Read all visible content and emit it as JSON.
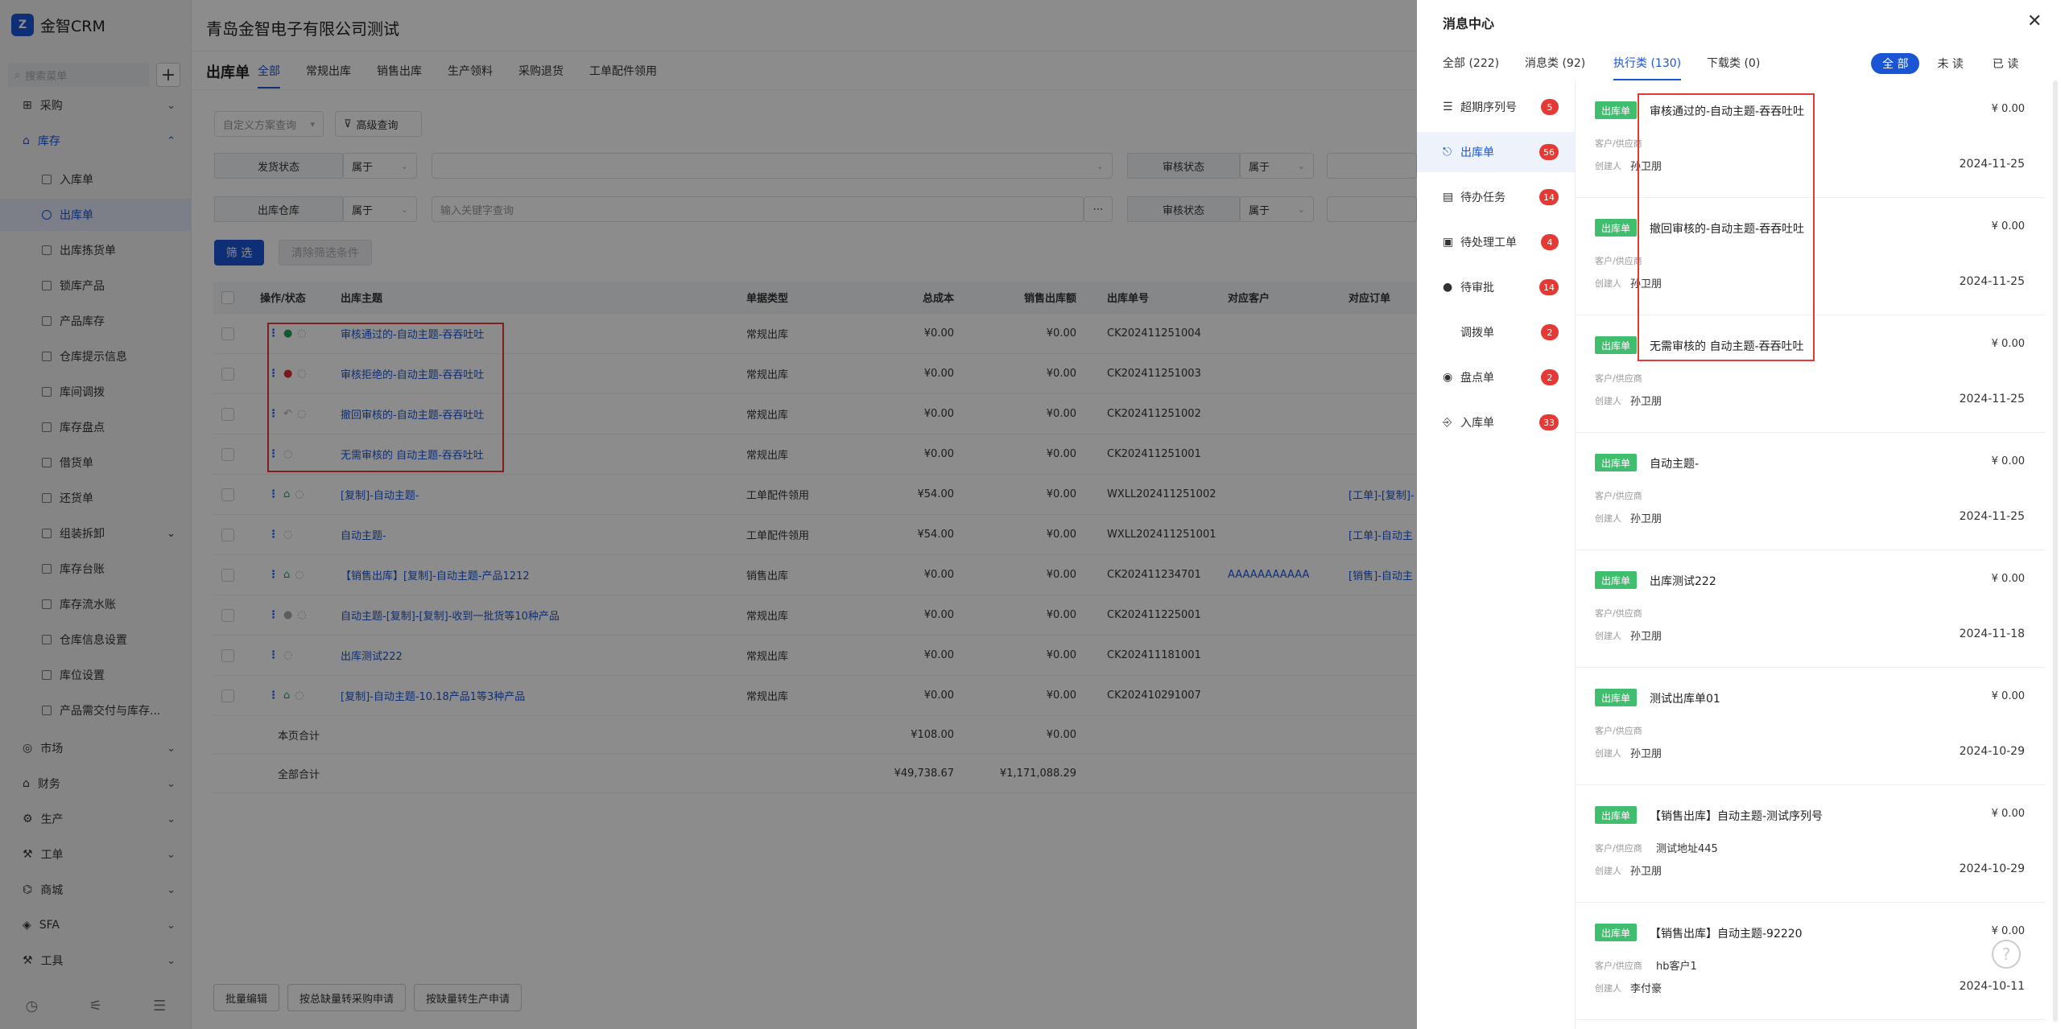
{
  "brand": {
    "name": "金智CRM",
    "logo_text": "Z"
  },
  "search": {
    "placeholder": "搜索菜单"
  },
  "sidebar": {
    "groups": [
      {
        "label": "采购",
        "icon": "cart-icon"
      },
      {
        "label": "库存",
        "icon": "warehouse-icon"
      }
    ],
    "sub_items": [
      "入库单",
      "出库单",
      "出库拣货单",
      "锁库产品",
      "产品库存",
      "仓库提示信息",
      "库间调拨",
      "库存盘点",
      "借货单",
      "还货单",
      "组装拆卸",
      "库存台账",
      "库存流水账",
      "仓库信息设置",
      "库位设置",
      "产品需交付与库存..."
    ],
    "lower_groups": [
      "市场",
      "财务",
      "生产",
      "工单",
      "商城",
      "SFA",
      "工具"
    ]
  },
  "header": {
    "company": "青岛金智电子有限公司测试"
  },
  "page": {
    "title": "出库单",
    "tabs": [
      "全部",
      "常规出库",
      "销售出库",
      "生产领料",
      "采购退货",
      "工单配件领用"
    ]
  },
  "filters": {
    "custom_query": "自定义方案查询",
    "advanced": "高级查询",
    "ship_status": "发货状态",
    "belongs": "属于",
    "audit_status": "审核状态",
    "warehouse": "出库仓库",
    "keyword_placeholder": "输入关键字查询",
    "filter_btn": "筛 选",
    "clear_btn": "清除筛选条件"
  },
  "table": {
    "headers": [
      "操作/状态",
      "出库主题",
      "单据类型",
      "总成本",
      "销售出库额",
      "出库单号",
      "对应客户",
      "对应订单"
    ],
    "rows": [
      {
        "status": "green-user",
        "subject": "审核通过的-自动主题-吞吞吐吐",
        "type": "常规出库",
        "cost": "¥0.00",
        "sales": "¥0.00",
        "no": "CK202411251004",
        "customer": "",
        "order": ""
      },
      {
        "status": "red-user",
        "subject": "审核拒绝的-自动主题-吞吞吐吐",
        "type": "常规出库",
        "cost": "¥0.00",
        "sales": "¥0.00",
        "no": "CK202411251003",
        "customer": "",
        "order": ""
      },
      {
        "status": "undo",
        "subject": "撤回审核的-自动主题-吞吞吐吐",
        "type": "常规出库",
        "cost": "¥0.00",
        "sales": "¥0.00",
        "no": "CK202411251002",
        "customer": "",
        "order": ""
      },
      {
        "status": "none",
        "subject": "无需审核的 自动主题-吞吞吐吐",
        "type": "常规出库",
        "cost": "¥0.00",
        "sales": "¥0.00",
        "no": "CK202411251001",
        "customer": "",
        "order": ""
      },
      {
        "status": "green-home",
        "subject": "[复制]-自动主题-",
        "type": "工单配件领用",
        "cost": "¥54.00",
        "sales": "¥0.00",
        "no": "WXLL202411251002",
        "customer": "",
        "order": "[工单]-[复制]-"
      },
      {
        "status": "none",
        "subject": "自动主题-",
        "type": "工单配件领用",
        "cost": "¥54.00",
        "sales": "¥0.00",
        "no": "WXLL202411251001",
        "customer": "",
        "order": "[工单]-自动主"
      },
      {
        "status": "green-home",
        "subject": "【销售出库】[复制]-自动主题-产品1212",
        "type": "销售出库",
        "cost": "¥0.00",
        "sales": "¥0.00",
        "no": "CK202411234701",
        "customer": "AAAAAAAAAAA",
        "order": "[销售]-自动主"
      },
      {
        "status": "grey-user",
        "subject": "自动主题-[复制]-[复制]-收到一批货等10种产品",
        "type": "常规出库",
        "cost": "¥0.00",
        "sales": "¥0.00",
        "no": "CK202411225001",
        "customer": "",
        "order": ""
      },
      {
        "status": "none",
        "subject": "出库测试222",
        "type": "常规出库",
        "cost": "¥0.00",
        "sales": "¥0.00",
        "no": "CK202411181001",
        "customer": "",
        "order": ""
      },
      {
        "status": "green-home",
        "subject": "[复制]-自动主题-10.18产品1等3种产品",
        "type": "常规出库",
        "cost": "¥0.00",
        "sales": "¥0.00",
        "no": "CK202410291007",
        "customer": "",
        "order": ""
      }
    ],
    "page_total": {
      "label": "本页合计",
      "cost": "¥108.00",
      "sales": "¥0.00"
    },
    "grand_total": {
      "label": "全部合计",
      "cost": "¥49,738.67",
      "sales": "¥1,171,088.29"
    }
  },
  "bottom_actions": [
    "批量编辑",
    "按总缺量转采购申请",
    "按缺量转生产申请"
  ],
  "drawer": {
    "title": "消息中心",
    "tabs": [
      "全部 (222)",
      "消息类 (92)",
      "执行类 (130)",
      "下载类 (0)"
    ],
    "filters": [
      "全 部",
      "未 读",
      "已 读"
    ],
    "categories": [
      {
        "label": "超期序列号",
        "badge": "5"
      },
      {
        "label": "出库单",
        "badge": "56"
      },
      {
        "label": "待办任务",
        "badge": "14"
      },
      {
        "label": "待处理工单",
        "badge": "4"
      },
      {
        "label": "待审批",
        "badge": "14"
      },
      {
        "label": "调拨单",
        "badge": "2"
      },
      {
        "label": "盘点单",
        "badge": "2"
      },
      {
        "label": "入库单",
        "badge": "33"
      }
    ],
    "msg_labels": {
      "tag": "出库单",
      "cust": "客户/供应商",
      "creator": "创建人"
    },
    "messages": [
      {
        "title": "审核通过的-自动主题-吞吞吐吐",
        "amount": "¥ 0.00",
        "customer": "",
        "creator": "孙卫朋",
        "date": "2024-11-25"
      },
      {
        "title": "撤回审核的-自动主题-吞吞吐吐",
        "amount": "¥ 0.00",
        "customer": "",
        "creator": "孙卫朋",
        "date": "2024-11-25"
      },
      {
        "title": "无需审核的 自动主题-吞吞吐吐",
        "amount": "¥ 0.00",
        "customer": "",
        "creator": "孙卫朋",
        "date": "2024-11-25"
      },
      {
        "title": "自动主题-",
        "amount": "¥ 0.00",
        "customer": "",
        "creator": "孙卫朋",
        "date": "2024-11-25"
      },
      {
        "title": "出库测试222",
        "amount": "¥ 0.00",
        "customer": "",
        "creator": "孙卫朋",
        "date": "2024-11-18"
      },
      {
        "title": "测试出库单01",
        "amount": "¥ 0.00",
        "customer": "",
        "creator": "孙卫朋",
        "date": "2024-10-29"
      },
      {
        "title": "【销售出库】自动主题-测试序列号",
        "amount": "¥ 0.00",
        "customer": "测试地址445",
        "creator": "孙卫朋",
        "date": "2024-10-29"
      },
      {
        "title": "【销售出库】自动主题-92220",
        "amount": "¥ 0.00",
        "customer": "hb客户1",
        "creator": "李付豪",
        "date": "2024-10-11"
      }
    ]
  }
}
